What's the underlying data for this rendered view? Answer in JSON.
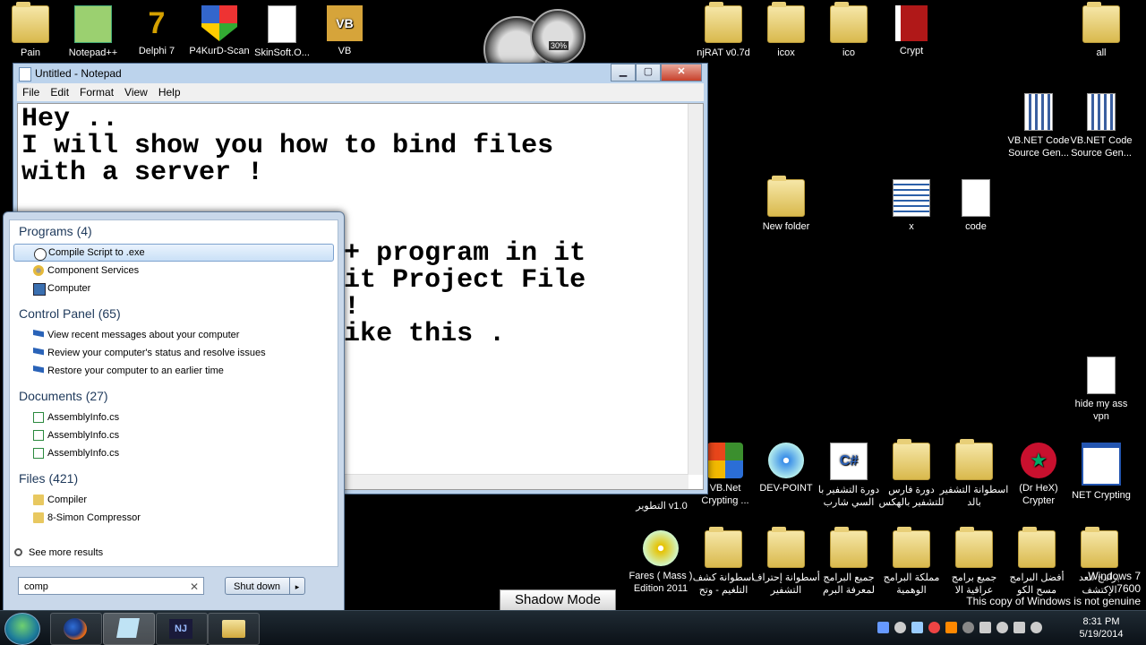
{
  "desktop_top": [
    {
      "label": "Pain",
      "icon": "user-icon"
    },
    {
      "label": "Notepad++",
      "icon": "notepad-plus-icon"
    },
    {
      "label": "Delphi 7",
      "icon": "delphi-icon"
    },
    {
      "label": "P4KurD-Scan",
      "icon": "shield-icon"
    },
    {
      "label": "SkinSoft.O...",
      "icon": "gear-document-icon"
    },
    {
      "label": "VB",
      "icon": "vb-icon"
    }
  ],
  "desktop_right_top": [
    {
      "label": "njRAT v0.7d",
      "icon": "folder-icon"
    },
    {
      "label": "icox",
      "icon": "folder-icon"
    },
    {
      "label": "ico",
      "icon": "folder-icon"
    },
    {
      "label": "Crypt",
      "icon": "crypt-book-icon"
    },
    {
      "label": "all",
      "icon": "folder-icon"
    }
  ],
  "desktop_right_mid": [
    {
      "label": "VB.NET Code Source Gen...",
      "icon": "calculator-doc-icon"
    },
    {
      "label": "VB.NET Code Source Gen...",
      "icon": "calculator-doc-icon"
    },
    {
      "label": "New folder",
      "icon": "folder-icon"
    },
    {
      "label": "x",
      "icon": "zip-icon"
    },
    {
      "label": "code",
      "icon": "document-icon"
    },
    {
      "label": "hide my ass vpn",
      "icon": "document-icon"
    }
  ],
  "desktop_row2": [
    {
      "label": "VB.Net Crypting ...",
      "icon": "windows-flag-icon"
    },
    {
      "label": "DEV-POINT",
      "icon": "disc-icon"
    },
    {
      "label": "دورة التشفير با السي شارب",
      "icon": "csharp-icon"
    },
    {
      "label": "دورة فارس للتشفير بالهكس",
      "icon": "folder-icon"
    },
    {
      "label": "اسطوانة التشفير بالد",
      "icon": "folder-icon"
    },
    {
      "label": "(Dr HeX) Crypter",
      "icon": "morocco-flag-icon"
    },
    {
      "label": "NET Crypting",
      "icon": "window-icon"
    }
  ],
  "desktop_row2_extra": "التطوير v1.0",
  "desktop_row3": [
    {
      "label": "Fares ( Mass ) Edition 2011",
      "icon": "dvd-icon"
    },
    {
      "label": "اسطوانة كشف التلغيم - وتح",
      "icon": "folder-icon"
    },
    {
      "label": "أسطوانة إحتراف التشفير",
      "icon": "folder-icon"
    },
    {
      "label": "جميع البرامج لمعرفة البرم",
      "icon": "folder-icon"
    },
    {
      "label": "مملكة البرامج الوهمية",
      "icon": "folder-icon"
    },
    {
      "label": "جميع برامج عراقية الا",
      "icon": "folder-icon"
    },
    {
      "label": "أفضل البرامج مسح الكو",
      "icon": "folder-icon"
    },
    {
      "label": "برامج لتعد الإكتشف",
      "icon": "folder-icon"
    }
  ],
  "notepad": {
    "title": "Untitled - Notepad",
    "menu": [
      "File",
      "Edit",
      "Format",
      "View",
      "Help"
    ],
    "lines": [
      "Hey ..",
      "I will show you how to bind files",
      "with a server !",
      "",
      "                 er",
      "                 er + program in it",
      "                  toit Project File",
      "                 it !",
      "                 t like this .",
      "",
      "",
      "                 ."
    ],
    "btn_min": "▁",
    "btn_max": "▢",
    "btn_close": "✕"
  },
  "startmenu": {
    "groups": [
      {
        "title": "Programs (4)",
        "items": [
          {
            "label": "Compile Script to .exe",
            "icon": "autoit-icon",
            "selected": true
          },
          {
            "label": "Component Services",
            "icon": "gears-icon"
          },
          {
            "label": "Computer",
            "icon": "computer-icon"
          }
        ]
      },
      {
        "title": "Control Panel (65)",
        "items": [
          {
            "label": "View recent messages about your computer",
            "icon": "flag-icon"
          },
          {
            "label": "Review your computer's status and resolve issues",
            "icon": "flag-icon"
          },
          {
            "label": "Restore your computer to an earlier time",
            "icon": "flag-icon"
          }
        ]
      },
      {
        "title": "Documents (27)",
        "items": [
          {
            "label": "AssemblyInfo.cs",
            "icon": "cs-file-icon"
          },
          {
            "label": "AssemblyInfo.cs",
            "icon": "cs-file-icon"
          },
          {
            "label": "AssemblyInfo.cs",
            "icon": "cs-file-icon"
          }
        ]
      },
      {
        "title": "Files (421)",
        "items": [
          {
            "label": "Compiler",
            "icon": "folder-icon"
          },
          {
            "label": "8-Simon Compressor",
            "icon": "folder-icon"
          }
        ]
      }
    ],
    "see_more": "See more results",
    "search_value": "comp",
    "search_clear": "✕",
    "shutdown_label": "Shut down",
    "shutdown_arrow": "▸"
  },
  "gadget": {
    "percent": "30%"
  },
  "shadow_mode": "Shadow Mode",
  "watermark": {
    "line1": "Windows 7",
    "line2": "7600",
    "line3": "This copy of Windows is not genuine"
  },
  "clock": {
    "time": "8:31 PM",
    "date": "5/19/2014"
  }
}
